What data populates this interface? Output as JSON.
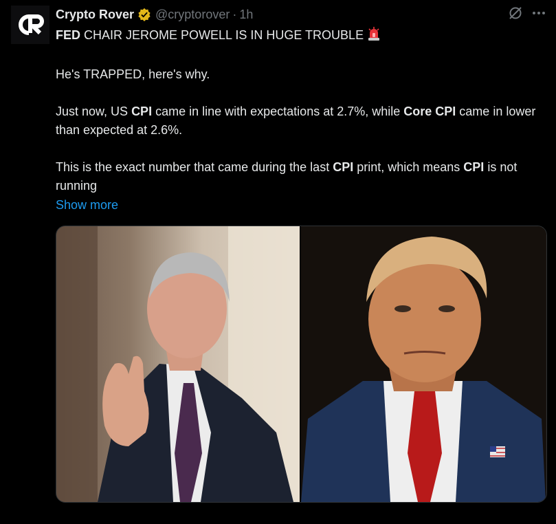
{
  "author": {
    "name": "Crypto Rover",
    "handle": "@cryptorover",
    "separator": "·",
    "time": "1h",
    "avatar_text": "CR"
  },
  "tweet": {
    "line1_bold": "FED",
    "line1_rest": " CHAIR JEROME POWELL IS IN HUGE TROUBLE",
    "line2": "He's TRAPPED, here's why.",
    "line3_a": "Just now, US ",
    "line3_b": "CPI",
    "line3_c": " came in line with expectations at 2.7%, while ",
    "line3_d": "Core CPI",
    "line3_e": " came in lower than expected at 2.6%.",
    "line4_a": "This is the exact number that came during the last ",
    "line4_b": "CPI",
    "line4_c": " print, which means ",
    "line4_d": "CPI",
    "line4_e": " is not running",
    "show_more": "Show more"
  },
  "icons": {
    "verified": "verified-badge-icon",
    "grok": "grok-icon",
    "more": "more-icon",
    "siren": "siren-icon"
  },
  "colors": {
    "background": "#000000",
    "text": "#e7e9ea",
    "muted": "#71767b",
    "link": "#1d9bf0",
    "verified_gold": "#e2b719"
  }
}
